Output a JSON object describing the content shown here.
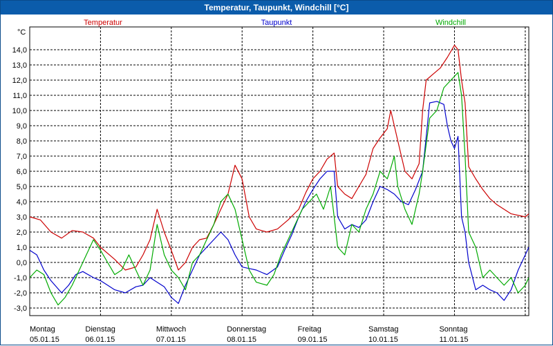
{
  "window": {
    "title": "Temperatur, Taupunkt, Windchill [°C]"
  },
  "chart_data": {
    "type": "line",
    "title": "Temperatur, Taupunkt, Windchill [°C]",
    "ylabel": "°C",
    "ylim": [
      -3.5,
      15.5
    ],
    "yticks": [
      -3.0,
      -2.0,
      -1.0,
      0.0,
      1.0,
      2.0,
      3.0,
      4.0,
      5.0,
      6.0,
      7.0,
      8.0,
      9.0,
      10.0,
      11.0,
      12.0,
      13.0,
      14.0
    ],
    "ytick_labels": [
      "-3,0",
      "-2,0",
      "-1,0",
      "0,0",
      "1,0",
      "2,0",
      "3,0",
      "4,0",
      "5,0",
      "6,0",
      "7,0",
      "8,0",
      "9,0",
      "10,0",
      "11,0",
      "12,0",
      "13,0",
      "14,0"
    ],
    "xlim": [
      0,
      7.05
    ],
    "x_categories": [
      {
        "day": "Montag",
        "date": "05.01.15"
      },
      {
        "day": "Dienstag",
        "date": "06.01.15"
      },
      {
        "day": "Mittwoch",
        "date": "07.01.15"
      },
      {
        "day": "Donnerstag",
        "date": "08.01.15"
      },
      {
        "day": "Freitag",
        "date": "09.01.15"
      },
      {
        "day": "Samstag",
        "date": "10.01.15"
      },
      {
        "day": "Sonntag",
        "date": "11.01.15"
      }
    ],
    "grid": true,
    "legend_position": "top",
    "series": [
      {
        "name": "Temperatur",
        "color": "#cc0000",
        "points": [
          [
            0,
            3.0
          ],
          [
            0.15,
            2.8
          ],
          [
            0.3,
            2.0
          ],
          [
            0.45,
            1.6
          ],
          [
            0.6,
            2.1
          ],
          [
            0.75,
            2.0
          ],
          [
            0.9,
            1.6
          ],
          [
            1.0,
            1.0
          ],
          [
            1.1,
            0.6
          ],
          [
            1.2,
            0.2
          ],
          [
            1.35,
            -0.5
          ],
          [
            1.5,
            -0.3
          ],
          [
            1.6,
            0.5
          ],
          [
            1.7,
            1.5
          ],
          [
            1.8,
            3.5
          ],
          [
            1.9,
            2.0
          ],
          [
            2.0,
            0.8
          ],
          [
            2.1,
            -0.5
          ],
          [
            2.2,
            0.0
          ],
          [
            2.3,
            1.0
          ],
          [
            2.4,
            1.5
          ],
          [
            2.5,
            1.6
          ],
          [
            2.6,
            2.5
          ],
          [
            2.7,
            3.5
          ],
          [
            2.8,
            4.5
          ],
          [
            2.9,
            6.4
          ],
          [
            3.0,
            5.5
          ],
          [
            3.1,
            3.0
          ],
          [
            3.2,
            2.2
          ],
          [
            3.35,
            2.0
          ],
          [
            3.5,
            2.2
          ],
          [
            3.65,
            2.8
          ],
          [
            3.8,
            3.5
          ],
          [
            3.9,
            4.6
          ],
          [
            4.0,
            5.5
          ],
          [
            4.1,
            6.0
          ],
          [
            4.2,
            6.8
          ],
          [
            4.3,
            7.2
          ],
          [
            4.35,
            5.0
          ],
          [
            4.45,
            4.5
          ],
          [
            4.55,
            4.2
          ],
          [
            4.65,
            5.0
          ],
          [
            4.75,
            5.8
          ],
          [
            4.85,
            7.5
          ],
          [
            4.95,
            8.2
          ],
          [
            5.05,
            8.8
          ],
          [
            5.1,
            10.0
          ],
          [
            5.2,
            8.0
          ],
          [
            5.3,
            6.0
          ],
          [
            5.4,
            5.5
          ],
          [
            5.5,
            6.5
          ],
          [
            5.55,
            10.0
          ],
          [
            5.6,
            12.0
          ],
          [
            5.7,
            12.4
          ],
          [
            5.8,
            12.8
          ],
          [
            5.9,
            13.5
          ],
          [
            6.0,
            14.3
          ],
          [
            6.05,
            14.0
          ],
          [
            6.1,
            12.0
          ],
          [
            6.15,
            10.5
          ],
          [
            6.2,
            6.3
          ],
          [
            6.3,
            5.5
          ],
          [
            6.4,
            4.8
          ],
          [
            6.5,
            4.2
          ],
          [
            6.6,
            3.8
          ],
          [
            6.8,
            3.2
          ],
          [
            7.0,
            3.0
          ],
          [
            7.05,
            3.2
          ]
        ]
      },
      {
        "name": "Taupunkt",
        "color": "#0000cc",
        "points": [
          [
            0,
            0.8
          ],
          [
            0.1,
            0.5
          ],
          [
            0.2,
            -0.5
          ],
          [
            0.3,
            -1.2
          ],
          [
            0.45,
            -2.0
          ],
          [
            0.55,
            -1.5
          ],
          [
            0.65,
            -0.8
          ],
          [
            0.75,
            -0.6
          ],
          [
            0.9,
            -1.0
          ],
          [
            1.0,
            -1.2
          ],
          [
            1.1,
            -1.5
          ],
          [
            1.2,
            -1.8
          ],
          [
            1.35,
            -2.0
          ],
          [
            1.5,
            -1.6
          ],
          [
            1.6,
            -1.5
          ],
          [
            1.7,
            -1.0
          ],
          [
            1.8,
            -1.3
          ],
          [
            1.9,
            -1.6
          ],
          [
            2.0,
            -2.3
          ],
          [
            2.1,
            -2.7
          ],
          [
            2.2,
            -1.5
          ],
          [
            2.3,
            -0.5
          ],
          [
            2.4,
            0.5
          ],
          [
            2.5,
            1.0
          ],
          [
            2.6,
            1.5
          ],
          [
            2.7,
            2.0
          ],
          [
            2.8,
            1.5
          ],
          [
            2.9,
            0.5
          ],
          [
            3.0,
            -0.3
          ],
          [
            3.1,
            -0.4
          ],
          [
            3.2,
            -0.5
          ],
          [
            3.35,
            -0.8
          ],
          [
            3.5,
            -0.3
          ],
          [
            3.6,
            0.8
          ],
          [
            3.7,
            1.8
          ],
          [
            3.8,
            3.0
          ],
          [
            3.9,
            4.0
          ],
          [
            4.0,
            4.8
          ],
          [
            4.1,
            5.5
          ],
          [
            4.2,
            6.0
          ],
          [
            4.3,
            6.0
          ],
          [
            4.35,
            3.0
          ],
          [
            4.45,
            2.2
          ],
          [
            4.55,
            2.5
          ],
          [
            4.65,
            2.3
          ],
          [
            4.75,
            2.8
          ],
          [
            4.85,
            4.0
          ],
          [
            4.95,
            5.0
          ],
          [
            5.05,
            4.8
          ],
          [
            5.15,
            4.5
          ],
          [
            5.25,
            4.0
          ],
          [
            5.35,
            3.8
          ],
          [
            5.45,
            4.8
          ],
          [
            5.55,
            6.0
          ],
          [
            5.65,
            10.5
          ],
          [
            5.75,
            10.6
          ],
          [
            5.85,
            10.4
          ],
          [
            5.9,
            9.0
          ],
          [
            5.95,
            8.0
          ],
          [
            6.0,
            7.5
          ],
          [
            6.05,
            8.3
          ],
          [
            6.1,
            3.0
          ],
          [
            6.15,
            2.0
          ],
          [
            6.2,
            0.0
          ],
          [
            6.3,
            -1.8
          ],
          [
            6.4,
            -1.5
          ],
          [
            6.5,
            -1.8
          ],
          [
            6.6,
            -2.0
          ],
          [
            6.7,
            -2.5
          ],
          [
            6.8,
            -1.8
          ],
          [
            6.9,
            -0.5
          ],
          [
            7.0,
            0.5
          ],
          [
            7.05,
            1.0
          ]
        ]
      },
      {
        "name": "Windchill",
        "color": "#00aa00",
        "points": [
          [
            0,
            -1.0
          ],
          [
            0.1,
            -0.5
          ],
          [
            0.2,
            -0.8
          ],
          [
            0.3,
            -2.0
          ],
          [
            0.4,
            -2.8
          ],
          [
            0.5,
            -2.3
          ],
          [
            0.6,
            -1.5
          ],
          [
            0.7,
            -0.5
          ],
          [
            0.8,
            0.5
          ],
          [
            0.9,
            1.5
          ],
          [
            1.0,
            0.8
          ],
          [
            1.1,
            0.0
          ],
          [
            1.2,
            -0.8
          ],
          [
            1.3,
            -0.5
          ],
          [
            1.4,
            0.5
          ],
          [
            1.5,
            -0.5
          ],
          [
            1.6,
            -1.5
          ],
          [
            1.7,
            -0.5
          ],
          [
            1.8,
            2.5
          ],
          [
            1.9,
            0.5
          ],
          [
            2.0,
            -0.5
          ],
          [
            2.1,
            -1.0
          ],
          [
            2.2,
            -1.8
          ],
          [
            2.3,
            0.0
          ],
          [
            2.4,
            0.5
          ],
          [
            2.5,
            1.5
          ],
          [
            2.6,
            2.5
          ],
          [
            2.7,
            4.0
          ],
          [
            2.8,
            4.5
          ],
          [
            2.9,
            3.5
          ],
          [
            3.0,
            1.5
          ],
          [
            3.1,
            -0.5
          ],
          [
            3.2,
            -1.3
          ],
          [
            3.35,
            -1.5
          ],
          [
            3.45,
            -0.8
          ],
          [
            3.55,
            0.5
          ],
          [
            3.65,
            1.5
          ],
          [
            3.75,
            2.5
          ],
          [
            3.85,
            3.5
          ],
          [
            3.95,
            4.0
          ],
          [
            4.05,
            4.5
          ],
          [
            4.15,
            3.5
          ],
          [
            4.25,
            5.0
          ],
          [
            4.3,
            3.0
          ],
          [
            4.35,
            1.0
          ],
          [
            4.45,
            0.5
          ],
          [
            4.55,
            2.5
          ],
          [
            4.65,
            2.0
          ],
          [
            4.75,
            3.5
          ],
          [
            4.85,
            4.5
          ],
          [
            4.95,
            6.0
          ],
          [
            5.05,
            5.5
          ],
          [
            5.1,
            6.2
          ],
          [
            5.15,
            7.0
          ],
          [
            5.2,
            5.0
          ],
          [
            5.3,
            3.5
          ],
          [
            5.4,
            2.5
          ],
          [
            5.5,
            4.5
          ],
          [
            5.55,
            6.0
          ],
          [
            5.65,
            9.5
          ],
          [
            5.75,
            10.0
          ],
          [
            5.85,
            11.5
          ],
          [
            5.95,
            12.0
          ],
          [
            6.05,
            12.5
          ],
          [
            6.1,
            11.0
          ],
          [
            6.15,
            7.0
          ],
          [
            6.2,
            2.0
          ],
          [
            6.3,
            1.0
          ],
          [
            6.4,
            -1.0
          ],
          [
            6.5,
            -0.5
          ],
          [
            6.6,
            -1.0
          ],
          [
            6.7,
            -1.5
          ],
          [
            6.8,
            -1.0
          ],
          [
            6.9,
            -2.0
          ],
          [
            7.0,
            -1.5
          ],
          [
            7.05,
            -1.0
          ]
        ]
      }
    ]
  }
}
